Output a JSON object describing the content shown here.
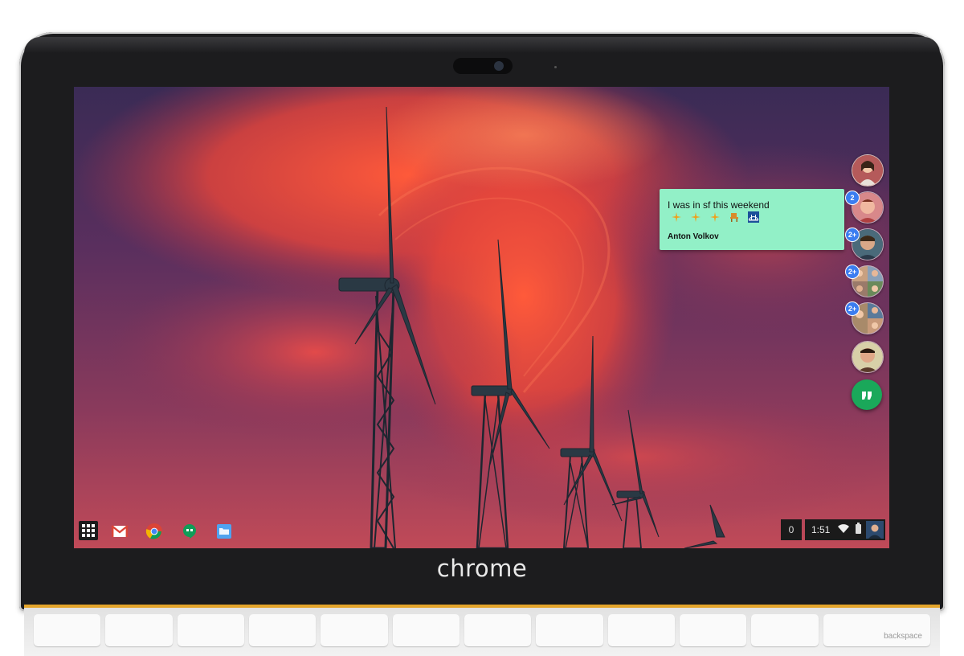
{
  "device": {
    "brand": "chrome",
    "keyboard": {
      "backspace_label": "backspace"
    }
  },
  "shelf": {
    "apps": [
      {
        "name": "Gmail",
        "icon": "gmail-icon"
      },
      {
        "name": "Chrome",
        "icon": "chrome-icon"
      },
      {
        "name": "Hangouts",
        "icon": "hangouts-icon"
      },
      {
        "name": "Files",
        "icon": "files-icon"
      }
    ],
    "notification_count": "0",
    "clock": "1:51",
    "status_icons": [
      "wifi-icon",
      "battery-icon",
      "account-avatar"
    ]
  },
  "notification": {
    "message": "I was in sf this weekend",
    "sender": "Anton Volkov",
    "emoji_icons": [
      "plane-icon",
      "plane-icon",
      "plane-icon",
      "chair-icon",
      "bridge-icon"
    ],
    "background": "#92f0c7"
  },
  "chat_heads": [
    {
      "name": "contact-1",
      "badge": ""
    },
    {
      "name": "contact-2",
      "badge": "2"
    },
    {
      "name": "contact-3",
      "badge": "2+"
    },
    {
      "name": "group-4",
      "badge": "2+"
    },
    {
      "name": "group-5",
      "badge": "2+"
    },
    {
      "name": "contact-6",
      "badge": ""
    }
  ],
  "colors": {
    "hangouts_green": "#1aa85a",
    "badge_blue": "#3b7df0",
    "bezel": "#1c1c1e",
    "keyboard_trim": "#e4a52c"
  }
}
